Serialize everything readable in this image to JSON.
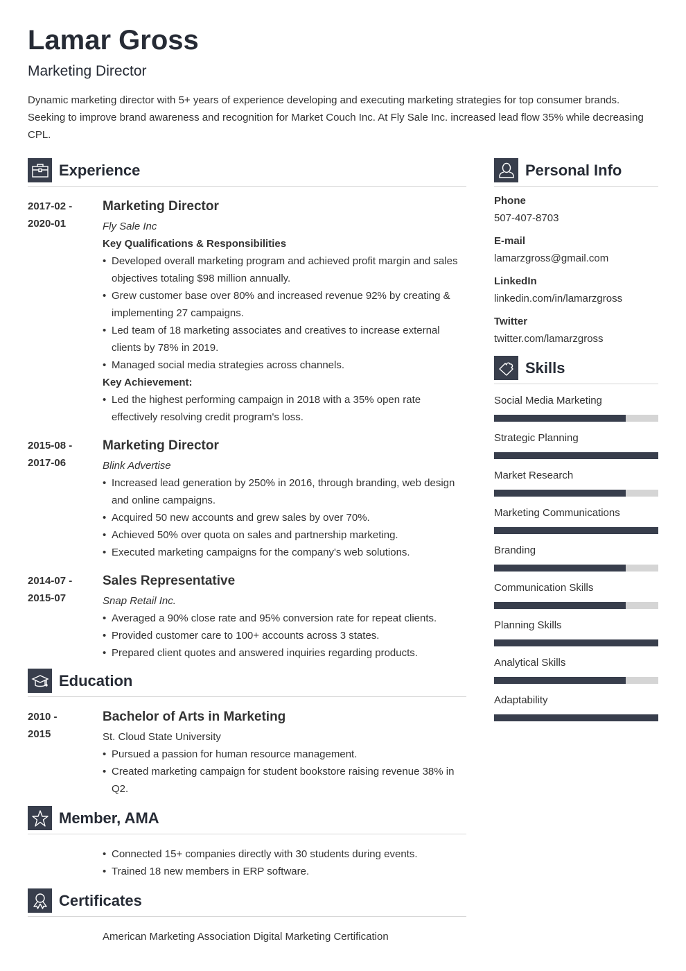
{
  "header": {
    "name": "Lamar Gross",
    "title": "Marketing Director",
    "summary": "Dynamic marketing director with 5+ years of experience developing and executing marketing strategies for top consumer brands. Seeking to improve brand awareness and recognition for Market Couch Inc. At Fly Sale Inc. increased lead flow 35% while decreasing CPL."
  },
  "sections": {
    "experience": "Experience",
    "education": "Education",
    "member": "Member, AMA",
    "certificates": "Certificates",
    "personal": "Personal Info",
    "skills": "Skills"
  },
  "icons": {
    "experience": "briefcase-icon",
    "education": "graduation-cap-icon",
    "member": "star-icon",
    "certificates": "award-ribbon-icon",
    "personal": "person-icon",
    "skills": "puzzle-piece-icon"
  },
  "experience": [
    {
      "date_start": "2017-02 -",
      "date_end": "2020-01",
      "job": "Marketing Director",
      "company": "Fly Sale Inc",
      "subhead1": "Key Qualifications & Responsibilities",
      "bullets1": [
        "Developed overall marketing program and achieved profit margin and sales objectives totaling $98 million annually.",
        "Grew customer base over 80% and increased revenue 92% by creating & implementing 27 campaigns.",
        "Led team of 18 marketing associates and creatives to increase external clients by 78% in 2019.",
        "Managed social media strategies across channels."
      ],
      "subhead2": "Key Achievement:",
      "bullets2": [
        "Led the highest performing campaign in 2018 with a 35% open rate effectively resolving credit program's loss."
      ]
    },
    {
      "date_start": "2015-08 -",
      "date_end": "2017-06",
      "job": "Marketing Director",
      "company": "Blink Advertise",
      "bullets1": [
        "Increased lead generation by 250% in 2016, through branding, web design and online campaigns.",
        "Acquired 50 new accounts and grew sales by over 70%.",
        "Achieved 50% over quota on sales and partnership marketing.",
        "Executed marketing campaigns for the company's web solutions."
      ]
    },
    {
      "date_start": "2014-07 -",
      "date_end": "2015-07",
      "job": "Sales Representative",
      "company": "Snap Retail Inc.",
      "bullets1": [
        "Averaged a 90% close rate and 95% conversion rate for repeat clients.",
        "Provided customer care to 100+ accounts across 3 states.",
        "Prepared client quotes and answered inquiries regarding products."
      ]
    }
  ],
  "education": {
    "date_start": "2010 -",
    "date_end": "2015",
    "degree": "Bachelor of Arts in Marketing",
    "school": "St. Cloud State University",
    "bullets": [
      "Pursued a passion for human resource management.",
      "Created marketing campaign for student bookstore raising revenue 38% in Q2."
    ]
  },
  "member": {
    "bullets": [
      "Connected 15+ companies directly with 30 students during events.",
      "Trained 18 new members in ERP software."
    ]
  },
  "certificates": {
    "items": [
      "American Marketing Association Digital Marketing Certification"
    ]
  },
  "personal": [
    {
      "label": "Phone",
      "value": "507-407-8703"
    },
    {
      "label": "E-mail",
      "value": "lamarzgross@gmail.com"
    },
    {
      "label": "LinkedIn",
      "value": "linkedin.com/in/lamarzgross"
    },
    {
      "label": "Twitter",
      "value": "twitter.com/lamarzgross"
    }
  ],
  "skills": [
    {
      "name": "Social Media Marketing",
      "level": 0.8
    },
    {
      "name": "Strategic Planning",
      "level": 1.0
    },
    {
      "name": "Market Research",
      "level": 0.8
    },
    {
      "name": "Marketing Communications",
      "level": 1.0
    },
    {
      "name": "Branding",
      "level": 0.8
    },
    {
      "name": "Communication Skills",
      "level": 0.8
    },
    {
      "name": "Planning Skills",
      "level": 1.0
    },
    {
      "name": "Analytical Skills",
      "level": 0.8
    },
    {
      "name": "Adaptability",
      "level": 1.0
    }
  ],
  "colors": {
    "accent": "#383e4c",
    "track": "#d5d5d5",
    "text": "#333333"
  }
}
